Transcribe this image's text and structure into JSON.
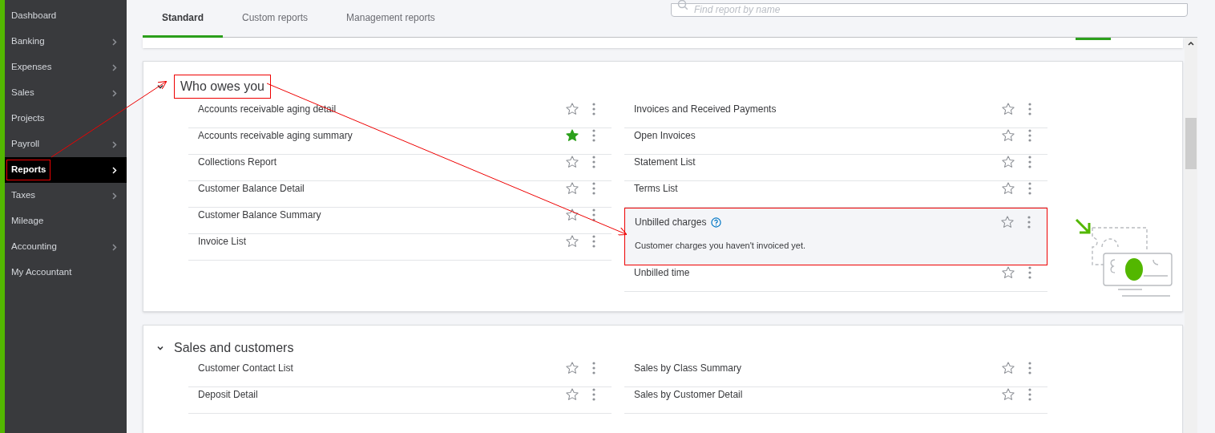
{
  "sidebar": {
    "items": [
      {
        "label": "Dashboard",
        "has_submenu": false,
        "selected": false
      },
      {
        "label": "Banking",
        "has_submenu": true,
        "selected": false
      },
      {
        "label": "Expenses",
        "has_submenu": true,
        "selected": false
      },
      {
        "label": "Sales",
        "has_submenu": true,
        "selected": false
      },
      {
        "label": "Projects",
        "has_submenu": false,
        "selected": false
      },
      {
        "label": "Payroll",
        "has_submenu": true,
        "selected": false
      },
      {
        "label": "Reports",
        "has_submenu": true,
        "selected": true
      },
      {
        "label": "Taxes",
        "has_submenu": true,
        "selected": false
      },
      {
        "label": "Mileage",
        "has_submenu": false,
        "selected": false
      },
      {
        "label": "Accounting",
        "has_submenu": true,
        "selected": false
      },
      {
        "label": "My Accountant",
        "has_submenu": false,
        "selected": false
      }
    ]
  },
  "tabs": [
    {
      "label": "Standard",
      "selected": true
    },
    {
      "label": "Custom reports",
      "selected": false
    },
    {
      "label": "Management reports",
      "selected": false
    }
  ],
  "search": {
    "placeholder": "Find report by name"
  },
  "sections": [
    {
      "title": "Who owes you",
      "expanded": true,
      "highlighted": true,
      "illustration": true,
      "columns": [
        [
          {
            "name": "Accounts receivable aging detail",
            "favorite": false
          },
          {
            "name": "Accounts receivable aging summary",
            "favorite": true
          },
          {
            "name": "Collections Report",
            "favorite": false
          },
          {
            "name": "Customer Balance Detail",
            "favorite": false
          },
          {
            "name": "Customer Balance Summary",
            "favorite": false
          },
          {
            "name": "Invoice List",
            "favorite": false
          }
        ],
        [
          {
            "name": "Invoices and Received Payments",
            "favorite": false
          },
          {
            "name": "Open Invoices",
            "favorite": false
          },
          {
            "name": "Statement List",
            "favorite": false
          },
          {
            "name": "Terms List",
            "favorite": false
          },
          {
            "name": "Unbilled charges",
            "favorite": false,
            "info": true,
            "description": "Customer charges you haven't invoiced yet.",
            "highlighted": true
          },
          {
            "name": "Unbilled time",
            "favorite": false
          }
        ]
      ]
    },
    {
      "title": "Sales and customers",
      "expanded": true,
      "highlighted": false,
      "illustration": false,
      "columns": [
        [
          {
            "name": "Customer Contact List",
            "favorite": false
          },
          {
            "name": "Deposit Detail",
            "favorite": false
          }
        ],
        [
          {
            "name": "Sales by Class Summary",
            "favorite": false
          },
          {
            "name": "Sales by Customer Detail",
            "favorite": false
          }
        ]
      ]
    }
  ]
}
